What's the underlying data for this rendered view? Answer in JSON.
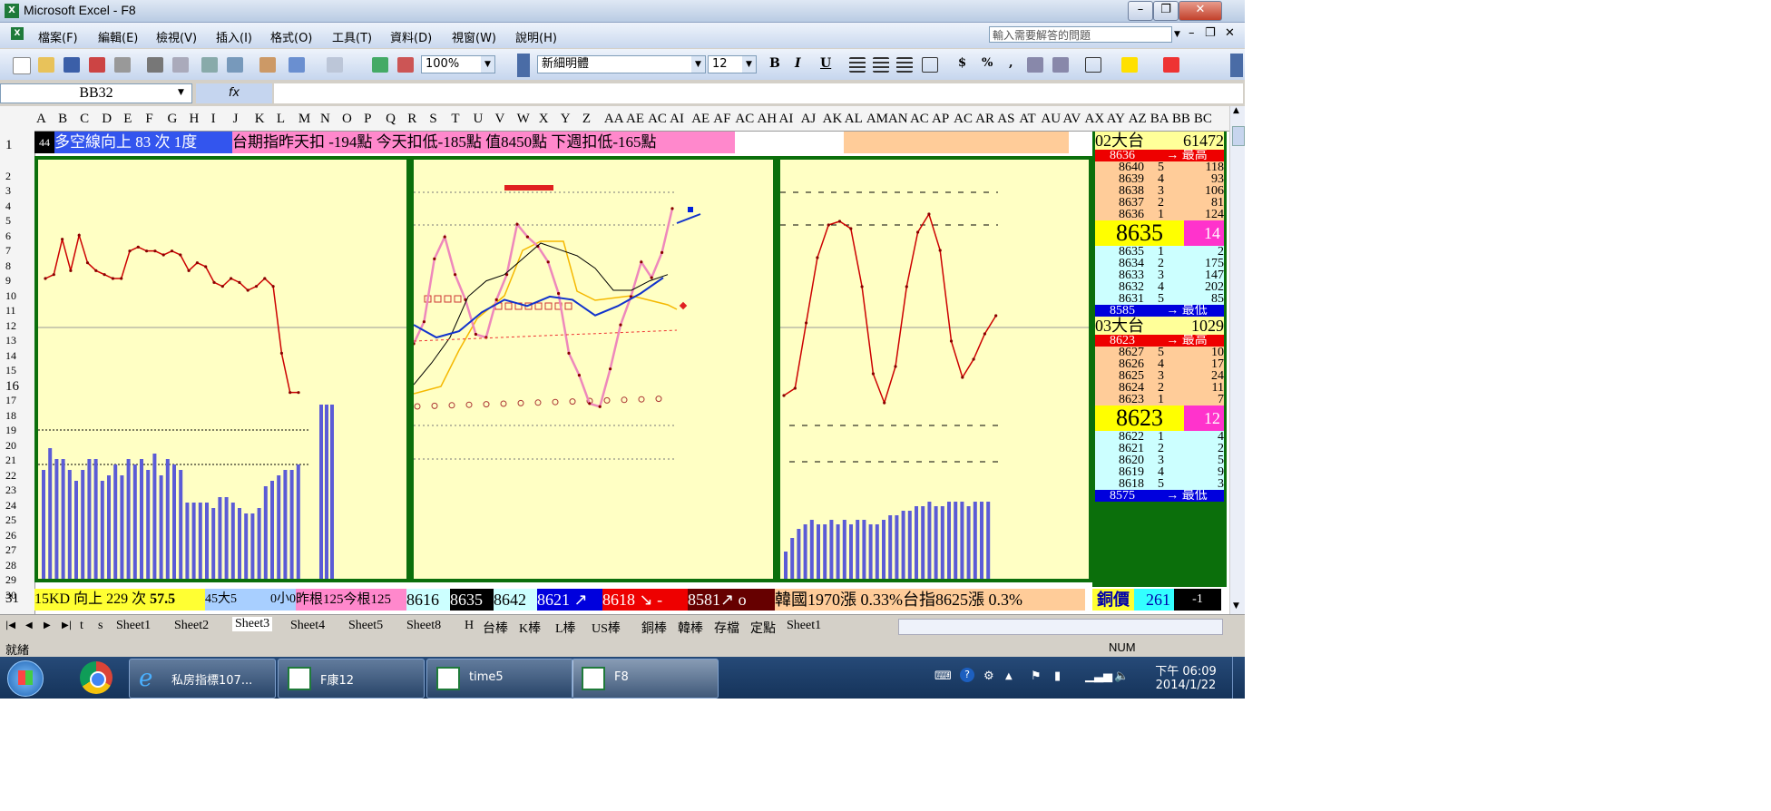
{
  "window": {
    "title": "Microsoft Excel - F8",
    "minimize": "–",
    "restore": "❐",
    "close": "✕",
    "doc_minimize": "–",
    "doc_restore": "❐",
    "doc_close": "✕"
  },
  "menu": {
    "items": [
      "檔案(F)",
      "編輯(E)",
      "檢視(V)",
      "插入(I)",
      "格式(O)",
      "工具(T)",
      "資料(D)",
      "視窗(W)",
      "說明(H)"
    ],
    "ask_placeholder": "輸入需要解答的問題"
  },
  "toolbar": {
    "zoom": "100%",
    "font": "新細明體",
    "font_size": "12",
    "bold": "B",
    "italic": "I",
    "underline": "U",
    "currency": "$",
    "percent": "%",
    "comma": ","
  },
  "formula_bar": {
    "name_box": "BB32",
    "fx": "fx",
    "formula": ""
  },
  "grid": {
    "columns": [
      "A",
      "B",
      "C",
      "D",
      "E",
      "F",
      "G",
      "H",
      "I",
      "J",
      "K",
      "L",
      "M",
      "N",
      "O",
      "P",
      "Q",
      "R",
      "S",
      "T",
      "U",
      "V",
      "W",
      "X",
      "Y",
      "Z",
      "AA",
      "AE",
      "AC",
      "AI",
      "AE",
      "AF",
      "AC",
      "AH",
      "AI",
      "AJ",
      "AK",
      "AL",
      "AM",
      "AN",
      "AC",
      "AP",
      "AC",
      "AR",
      "AS",
      "AT",
      "AU",
      "AV",
      "AX",
      "AY",
      "AZ",
      "BA",
      "BB",
      "BC"
    ],
    "rows": [
      "1",
      "2",
      "3",
      "4",
      "5",
      "6",
      "7",
      "8",
      "9",
      "10",
      "11",
      "12",
      "13",
      "14",
      "15",
      "16",
      "17",
      "18",
      "19",
      "20",
      "21",
      "22",
      "23",
      "24",
      "25",
      "26",
      "27",
      "28",
      "29",
      "30",
      "31"
    ],
    "row1": {
      "a1": "44",
      "b1": "多空線向上 83 次 1度",
      "k1": "台期指昨天扣 -194點 今天扣低-185點 值8450點 下週扣低-165點"
    },
    "row31": {
      "kd": "15KD 向上 229 次",
      "kd_val": "57.5",
      "big_small": "45大5",
      "small": "0小0",
      "roots": "昨根125今根125",
      "v1": "8616",
      "v2": "8635",
      "v3": "8642",
      "v4": "8621",
      "v4_arrow": "↗",
      "v5": "8618",
      "v5_arrow": "↘",
      "v5_sign": "-",
      "v6": "8581",
      "v6_arrow": "↗",
      "v6_sign": "o",
      "news": "韓國1970漲 0.33%台指8625漲 0.3%",
      "copper": "銅價",
      "copper_val": "261",
      "copper_chg": "-1"
    }
  },
  "ladder": {
    "contract1": {
      "name": "02大台",
      "volume": "61472"
    },
    "high1": {
      "price": "8636",
      "label": "→ 最高"
    },
    "asks1": [
      [
        "8640",
        "5",
        "118"
      ],
      [
        "8639",
        "4",
        "93"
      ],
      [
        "8638",
        "3",
        "106"
      ],
      [
        "8637",
        "2",
        "81"
      ],
      [
        "8636",
        "1",
        "124"
      ]
    ],
    "last1": {
      "price": "8635",
      "qty": "14"
    },
    "bids1": [
      [
        "8635",
        "1",
        "2"
      ],
      [
        "8634",
        "2",
        "175"
      ],
      [
        "8633",
        "3",
        "147"
      ],
      [
        "8632",
        "4",
        "202"
      ],
      [
        "8631",
        "5",
        "85"
      ]
    ],
    "low1": {
      "price": "8585",
      "label": "→ 最低"
    },
    "contract2": {
      "name": "03大台",
      "volume": "1029"
    },
    "high2": {
      "price": "8623",
      "label": "→ 最高"
    },
    "asks2": [
      [
        "8627",
        "5",
        "10"
      ],
      [
        "8626",
        "4",
        "17"
      ],
      [
        "8625",
        "3",
        "24"
      ],
      [
        "8624",
        "2",
        "11"
      ],
      [
        "8623",
        "1",
        "7"
      ]
    ],
    "last2": {
      "price": "8623",
      "qty": "12"
    },
    "bids2": [
      [
        "8622",
        "1",
        "4"
      ],
      [
        "8621",
        "2",
        "2"
      ],
      [
        "8620",
        "3",
        "5"
      ],
      [
        "8619",
        "4",
        "9"
      ],
      [
        "8618",
        "5",
        "3"
      ]
    ],
    "low2": {
      "price": "8575",
      "label": "→ 最低"
    }
  },
  "sheet_tabs": [
    "t",
    "s",
    "Sheet1",
    "Sheet2",
    "Sheet3",
    "Sheet4",
    "Sheet5",
    "Sheet8",
    "H",
    "台棒",
    "K棒",
    "L棒",
    "US棒",
    "銅棒",
    "韓棒",
    "存檔",
    "定點",
    "Sheet1"
  ],
  "active_tab": "Sheet3",
  "status": {
    "ready": "就緒",
    "num": "NUM"
  },
  "taskbar": {
    "items": [
      "私房指標107...",
      "F康12",
      "time5",
      "F8"
    ],
    "time": "下午 06:09",
    "date": "2014/1/22"
  },
  "colors": {
    "panel_bg": "#ffffc4",
    "panel_border": "#0b6f0b",
    "red_line": "#cc0000",
    "bar_blue": "#5b5bd6",
    "pink": "#ee88bb",
    "orange": "#f5b800"
  },
  "chart_data": [
    {
      "type": "line",
      "series": [
        {
          "values": [
            8629,
            8630,
            8639,
            8631,
            8640,
            8633,
            8631,
            8630,
            8629,
            8629,
            8636,
            8637,
            8636,
            8636,
            8635,
            8636,
            8635,
            8631,
            8633,
            8632,
            8628,
            8627,
            8629,
            8628,
            8626,
            8627,
            8629,
            8627,
            8610,
            8600,
            8600
          ]
        }
      ],
      "bars": [
        20,
        24,
        22,
        22,
        20,
        18,
        20,
        22,
        22,
        18,
        19,
        21,
        19,
        22,
        21,
        22,
        20,
        23,
        19,
        22,
        21,
        20,
        14,
        14,
        14,
        14,
        13,
        15,
        15,
        14,
        13,
        12,
        12,
        13,
        17,
        18,
        19,
        20,
        20,
        21
      ]
    },
    {
      "type": "line",
      "series": [
        {
          "values": [
            8598,
            8605,
            8625,
            8632,
            8620,
            8612,
            8601,
            8600,
            8612,
            8620,
            8636,
            8632,
            8629,
            8624,
            8614,
            8595,
            8588,
            8579,
            8578,
            8590,
            8604,
            8613,
            8624,
            8619,
            8627,
            8641
          ]
        },
        {
          "values": [
            8585,
            8592,
            8600,
            8613,
            8618,
            8620,
            8625,
            8630,
            8628,
            8626,
            8622,
            8615,
            8615,
            8618,
            8620
          ]
        },
        {
          "values": [
            8604,
            8600,
            8602,
            8608,
            8612,
            8610,
            8613,
            8612,
            8607,
            8610,
            8614,
            8619
          ]
        }
      ]
    },
    {
      "type": "line",
      "series": [
        {
          "values": [
            8590,
            8592,
            8610,
            8628,
            8637,
            8638,
            8636,
            8620,
            8596,
            8588,
            8598,
            8620,
            8635,
            8640,
            8630,
            8605,
            8595,
            8600,
            8607,
            8612
          ]
        }
      ],
      "bars": [
        6,
        9,
        11,
        12,
        13,
        12,
        12,
        13,
        12,
        13,
        12,
        13,
        13,
        12,
        12,
        13,
        14,
        14,
        15,
        15,
        16,
        16,
        17,
        16,
        16,
        17,
        17,
        17,
        16,
        17,
        17,
        17
      ]
    }
  ]
}
